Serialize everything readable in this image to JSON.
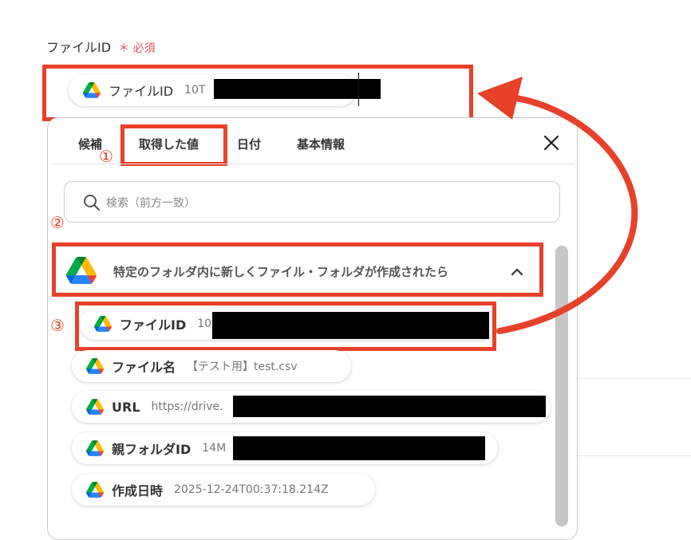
{
  "field": {
    "label": "ファイルID",
    "required_mark": "＊",
    "required_text": "必須",
    "chip_label": "ファイルID",
    "chip_value": "10T"
  },
  "tabs": [
    {
      "label": "候補"
    },
    {
      "label": "取得した値"
    },
    {
      "label": "日付"
    },
    {
      "label": "基本情報"
    }
  ],
  "search": {
    "placeholder": "検索（前方一致）"
  },
  "section": {
    "title": "特定のフォルダ内に新しくファイル・フォルダが作成されたら"
  },
  "items": [
    {
      "label": "ファイルID",
      "value": "10"
    },
    {
      "label": "ファイル名",
      "value": "【テスト用】test.csv"
    },
    {
      "label": "URL",
      "value": "https://drive."
    },
    {
      "label": "親フォルダID",
      "value": "14M"
    },
    {
      "label": "作成日時",
      "value": "2025-12-24T00:37:18.214Z"
    }
  ],
  "annotations": {
    "step1": "①",
    "step2": "②",
    "step3": "③",
    "highlight_color": "#e8412a"
  },
  "icons": {
    "service": "google-drive-icon",
    "close": "close-icon",
    "search": "search-icon",
    "collapse": "chevron-up-icon"
  }
}
